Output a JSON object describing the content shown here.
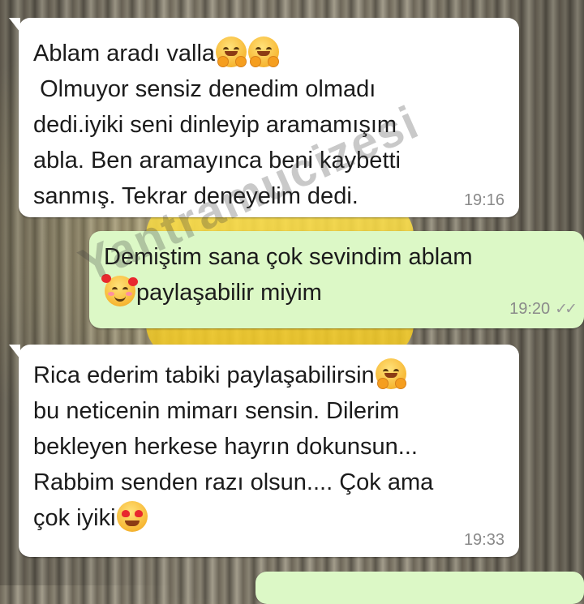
{
  "messages": [
    {
      "id": "m1",
      "direction": "incoming",
      "lines": [
        "Ablam aradı valla",
        " Olmuyor sensiz denedim olmadı",
        "dedi.iyiki seni dinleyip aramamışım",
        "abla. Ben aramayınca beni kaybetti",
        "sanmış. Tekrar deneyelim dedi."
      ],
      "emojis": [
        "hugging-face",
        "hugging-face"
      ],
      "time": "19:16"
    },
    {
      "id": "m2",
      "direction": "outgoing",
      "lines": [
        "Demiştim sana çok sevindim ablam",
        "paylaşabilir miyim"
      ],
      "emojis": [
        "smiling-face-with-hearts"
      ],
      "time": "19:20",
      "status": "read"
    },
    {
      "id": "m3",
      "direction": "incoming",
      "lines": [
        "Rica ederim tabiki paylaşabilirsin",
        "bu neticenin mimarı sensin. Dilerim",
        "bekleyen herkese hayrın dokunsun...",
        "Rabbim senden razı olsun.... Çok ama",
        "çok iyiki"
      ],
      "emojis": [
        "hugging-face",
        "heart-eyes"
      ],
      "time": "19:33"
    }
  ],
  "watermark": "Yantramucizesi",
  "colors": {
    "incoming_bubble": "#ffffff",
    "outgoing_bubble": "#dcf8c6",
    "timestamp": "#8a8a8a"
  }
}
